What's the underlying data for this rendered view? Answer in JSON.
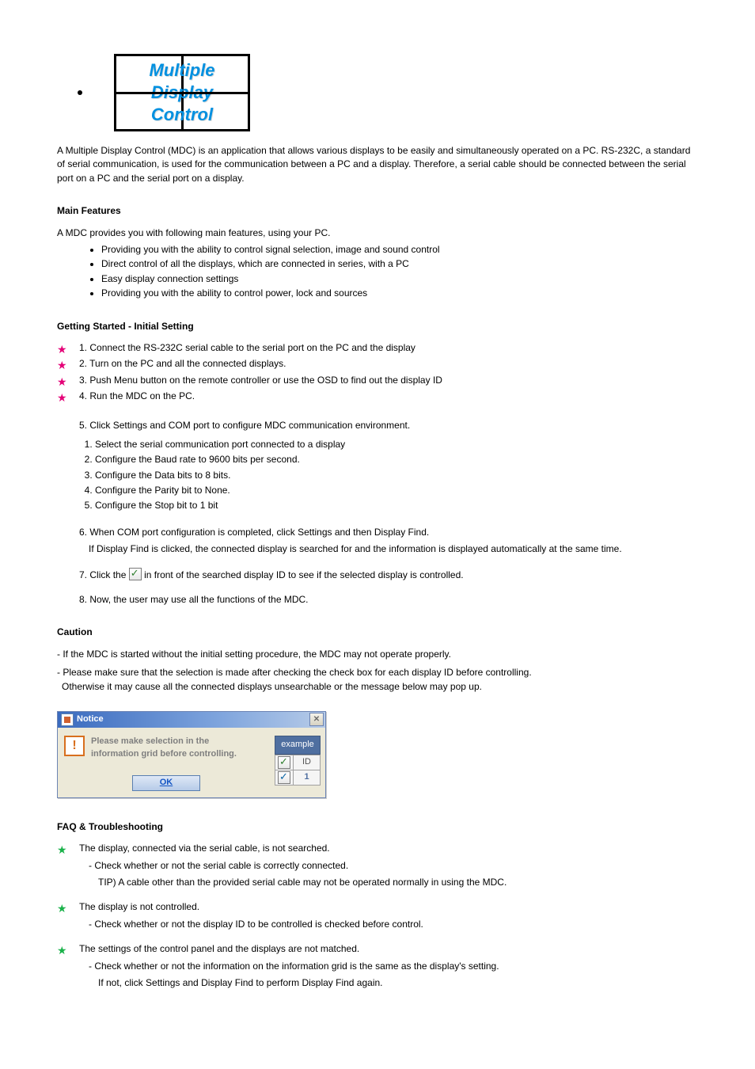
{
  "logo": {
    "line1": "Multiple",
    "line2": "Display",
    "line3": "Control"
  },
  "intro": "A Multiple Display Control (MDC) is an application that allows various displays to be easily and simultaneously operated on a PC. RS-232C, a standard of serial communication, is used for the communication between a PC and a display. Therefore, a serial cable should be connected between the serial port on a PC and the serial port on a display.",
  "main_features": {
    "heading": "Main Features",
    "lead": "A MDC provides you with following main features, using your PC.",
    "items": [
      "Providing you with the ability to control signal selection, image and sound control",
      "Direct control of all the displays, which are connected in series, with a PC",
      "Easy display connection settings",
      "Providing you with the ability to control power, lock and sources"
    ]
  },
  "getting_started": {
    "heading": "Getting Started - Initial Setting",
    "steps": [
      {
        "text": "Connect the RS-232C serial cable to the serial port on the PC and the display",
        "num": "1."
      },
      {
        "text": "Turn on the PC and all the connected displays.",
        "num": "2."
      },
      {
        "text": "Push Menu button on the remote controller or use the OSD to find out the display ID",
        "num": "3."
      },
      {
        "text": "Run the MDC on the PC.",
        "num": "4."
      }
    ],
    "step5": {
      "num": "5.",
      "line1": "Click Settings and COM port to configure MDC communication environment.",
      "sub": [
        "Select the serial communication port connected to a display",
        "Configure the Baud rate to 9600 bits per second.",
        "Configure the Data bits to 8 bits.",
        "Configure the Parity bit to None.",
        "Configure the Stop bit to 1 bit"
      ]
    },
    "step6": {
      "num": "6.",
      "line1": "When COM port configuration is completed, click Settings and then Display Find.",
      "line2": "If Display Find is clicked, the connected display is searched for and the information is displayed automatically at the same time."
    },
    "step7": {
      "num": "7.",
      "pre": "Click the",
      "post": "in front of the searched display ID to see if the selected display is controlled."
    },
    "step8": {
      "num": "8.",
      "text": "Now, the user may use all the functions of the MDC."
    }
  },
  "caution": {
    "heading": "Caution",
    "line1": "- If the MDC is started without the initial setting procedure, the MDC may not operate properly.",
    "line2": "- Please make sure that the selection is made after checking the check box for each display ID before controlling.",
    "line3": "Otherwise it may cause all the connected displays unsearchable or the message below may pop up."
  },
  "notice": {
    "title": "Notice",
    "message": "Please make selection in the\ninformation grid before controlling.",
    "ok": "OK",
    "example_label": "example",
    "id_header": "ID",
    "id_value": "1"
  },
  "faq": {
    "heading": "FAQ & Troubleshooting",
    "q1": {
      "q": "The display, connected via the serial cable, is not searched.",
      "a_pre": "- Check whether or not the serial cable is correctly connected.",
      "tip": "TIP) A cable other than the provided serial cable may not be operated normally in using the MDC."
    },
    "q2": {
      "q": "The display is not controlled.",
      "a": "- Check whether or not the display ID to be controlled is checked before control."
    },
    "q3": {
      "q": "The settings of the control panel and the displays are not matched.",
      "a1": "- Check whether or not the information on the information grid is the same as the display's setting.",
      "a2": "If not, click Settings and Display Find to perform Display Find again."
    }
  }
}
